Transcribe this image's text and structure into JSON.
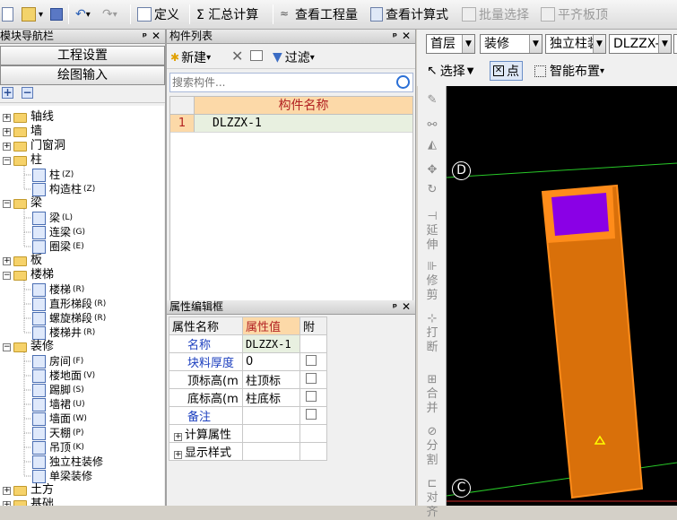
{
  "toolbar": {
    "define": "定义",
    "summary": "Σ 汇总计算",
    "view_quantity": "查看工程量",
    "view_formula": "查看计算式",
    "batch_select": "批量选择",
    "flush_slab": "平齐板顶"
  },
  "nav": {
    "title": "模块导航栏",
    "pin": "ᵖ",
    "close": "✕",
    "project_settings": "工程设置",
    "drawing_input": "绘图输入",
    "tree": [
      {
        "label": "轴线",
        "level": 0,
        "expanded": false
      },
      {
        "label": "墙",
        "level": 0,
        "expanded": false
      },
      {
        "label": "门窗洞",
        "level": 0,
        "expanded": false
      },
      {
        "label": "柱",
        "level": 0,
        "expanded": true
      },
      {
        "label": "柱",
        "key": "(Z)",
        "level": 1
      },
      {
        "label": "构造柱",
        "key": "(Z)",
        "level": 1
      },
      {
        "label": "梁",
        "level": 0,
        "expanded": true
      },
      {
        "label": "梁",
        "key": "(L)",
        "level": 1
      },
      {
        "label": "连梁",
        "key": "(G)",
        "level": 1
      },
      {
        "label": "圈梁",
        "key": "(E)",
        "level": 1
      },
      {
        "label": "板",
        "level": 0,
        "expanded": false
      },
      {
        "label": "楼梯",
        "level": 0,
        "expanded": true
      },
      {
        "label": "楼梯",
        "key": "(R)",
        "level": 1
      },
      {
        "label": "直形梯段",
        "key": "(R)",
        "level": 1
      },
      {
        "label": "螺旋梯段",
        "key": "(R)",
        "level": 1
      },
      {
        "label": "楼梯井",
        "key": "(R)",
        "level": 1
      },
      {
        "label": "装修",
        "level": 0,
        "expanded": true
      },
      {
        "label": "房间",
        "key": "(F)",
        "level": 1
      },
      {
        "label": "楼地面",
        "key": "(V)",
        "level": 1
      },
      {
        "label": "踢脚",
        "key": "(S)",
        "level": 1
      },
      {
        "label": "墙裙",
        "key": "(U)",
        "level": 1
      },
      {
        "label": "墙面",
        "key": "(W)",
        "level": 1
      },
      {
        "label": "天棚",
        "key": "(P)",
        "level": 1
      },
      {
        "label": "吊顶",
        "key": "(K)",
        "level": 1
      },
      {
        "label": "独立柱装修",
        "key": "",
        "level": 1
      },
      {
        "label": "单梁装修",
        "key": "",
        "level": 1
      },
      {
        "label": "土方",
        "level": 0,
        "expanded": false
      },
      {
        "label": "基础",
        "level": 0,
        "expanded": false
      }
    ]
  },
  "component_list": {
    "title": "构件列表",
    "new_label": "新建",
    "filter_label": "过滤",
    "search_placeholder": "搜索构件...",
    "column_header": "构件名称",
    "rows": [
      {
        "index": "1",
        "name": "DLZZX-1"
      }
    ]
  },
  "property_editor": {
    "title": "属性编辑框",
    "headers": {
      "name": "属性名称",
      "value": "属性值",
      "extra": "附"
    },
    "rows": [
      {
        "name": "名称",
        "value": "DLZZX-1",
        "check": false,
        "blue": true
      },
      {
        "name": "块料厚度",
        "value": "0",
        "check": true,
        "blue": true
      },
      {
        "name": "顶标高(m",
        "value": "柱顶标",
        "check": true,
        "blue": false
      },
      {
        "name": "底标高(m",
        "value": "柱底标",
        "check": true,
        "blue": false
      },
      {
        "name": "备注",
        "value": "",
        "check": true,
        "blue": true
      }
    ],
    "groups": [
      "计算属性",
      "显示样式"
    ]
  },
  "drawing": {
    "floor": "首层",
    "category": "装修",
    "type": "独立柱装",
    "component": "DLZZX-",
    "select_label": "选择",
    "point_label": "点",
    "smart_layout_label": "智能布置",
    "axis_labels": [
      "D",
      "C"
    ],
    "side_tools": [
      "延伸",
      "修剪",
      "打断",
      "合并",
      "分割",
      "对齐"
    ]
  },
  "colors": {
    "column": "#d9700a",
    "column_border": "#ff8c1a",
    "core": "#8a00e6",
    "axis": "#28c828",
    "grid_line": "#c82828",
    "header_fill": "#fcd9a8"
  }
}
